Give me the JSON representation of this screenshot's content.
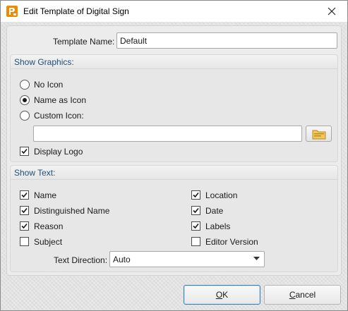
{
  "window": {
    "title": "Edit Template of Digital Sign"
  },
  "template_name": {
    "label": "Template Name:",
    "value": "Default"
  },
  "show_graphics": {
    "header": "Show Graphics:",
    "options": [
      {
        "label": "No Icon",
        "checked": false
      },
      {
        "label": "Name as Icon",
        "checked": true
      },
      {
        "label": "Custom Icon:",
        "checked": false
      }
    ],
    "custom_icon_path": "",
    "display_logo": {
      "label": "Display Logo",
      "checked": true
    }
  },
  "show_text": {
    "header": "Show Text:",
    "left_items": [
      {
        "label": "Name",
        "checked": true
      },
      {
        "label": "Distinguished Name",
        "checked": true
      },
      {
        "label": "Reason",
        "checked": true
      },
      {
        "label": "Subject",
        "checked": false
      }
    ],
    "right_items": [
      {
        "label": "Location",
        "checked": true
      },
      {
        "label": "Date",
        "checked": true
      },
      {
        "label": "Labels",
        "checked": true
      },
      {
        "label": "Editor Version",
        "checked": false
      }
    ],
    "text_direction": {
      "label": "Text Direction:",
      "value": "Auto"
    }
  },
  "buttons": {
    "ok_mnemonic": "O",
    "ok_rest": "K",
    "cancel_mnemonic": "C",
    "cancel_rest": "ancel"
  },
  "colors": {
    "section_header_text": "#1f4e79",
    "app_icon": "#f08a00",
    "default_button_border": "#3c7fb1"
  },
  "icons": {
    "app": "pdf-editor-app-icon",
    "close": "close-icon",
    "browse": "folder-icon",
    "dropdown": "chevron-down-icon"
  }
}
